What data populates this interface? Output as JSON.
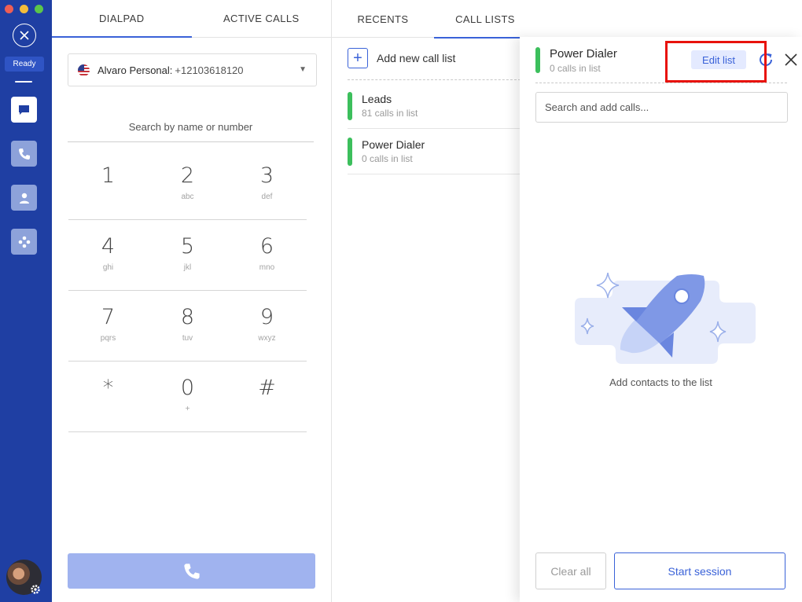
{
  "sidebar": {
    "status": "Ready",
    "buttons": [
      {
        "icon": "chat-icon",
        "active": true
      },
      {
        "icon": "phone-icon",
        "active": false
      },
      {
        "icon": "person-icon",
        "active": false
      },
      {
        "icon": "apps-icon",
        "active": false
      }
    ]
  },
  "dialpad_panel": {
    "tabs": [
      "DIALPAD",
      "ACTIVE CALLS"
    ],
    "active_tab": "DIALPAD",
    "caller_id": {
      "name": "Alvaro Personal:",
      "number": "+12103618120"
    },
    "search_placeholder": "Search by name or number",
    "keys": [
      [
        {
          "digit": "1",
          "letters": ""
        },
        {
          "digit": "2",
          "letters": "abc"
        },
        {
          "digit": "3",
          "letters": "def"
        }
      ],
      [
        {
          "digit": "4",
          "letters": "ghi"
        },
        {
          "digit": "5",
          "letters": "jkl"
        },
        {
          "digit": "6",
          "letters": "mno"
        }
      ],
      [
        {
          "digit": "7",
          "letters": "pqrs"
        },
        {
          "digit": "8",
          "letters": "tuv"
        },
        {
          "digit": "9",
          "letters": "wxyz"
        }
      ],
      [
        {
          "digit": "*",
          "letters": ""
        },
        {
          "digit": "0",
          "letters": "+"
        },
        {
          "digit": "#",
          "letters": ""
        }
      ]
    ]
  },
  "lists_panel": {
    "tabs": [
      "RECENTS",
      "CALL LISTS"
    ],
    "active_tab": "CALL LISTS",
    "add_label": "Add new call list",
    "lists": [
      {
        "title": "Leads",
        "subtitle": "81 calls in list"
      },
      {
        "title": "Power Dialer",
        "subtitle": "0 calls in list"
      }
    ]
  },
  "drawer": {
    "title": "Power Dialer",
    "subtitle": "0 calls in list",
    "edit_label": "Edit list",
    "search_placeholder": "Search and add calls...",
    "empty_text": "Add contacts to the list",
    "clear_label": "Clear all",
    "start_label": "Start session"
  },
  "colors": {
    "rail": "#1f3fa3",
    "accent": "#3a62d8",
    "list_bar": "#3cbf5c",
    "highlight": "#e8120b",
    "call_button": "#a0b3ef"
  }
}
